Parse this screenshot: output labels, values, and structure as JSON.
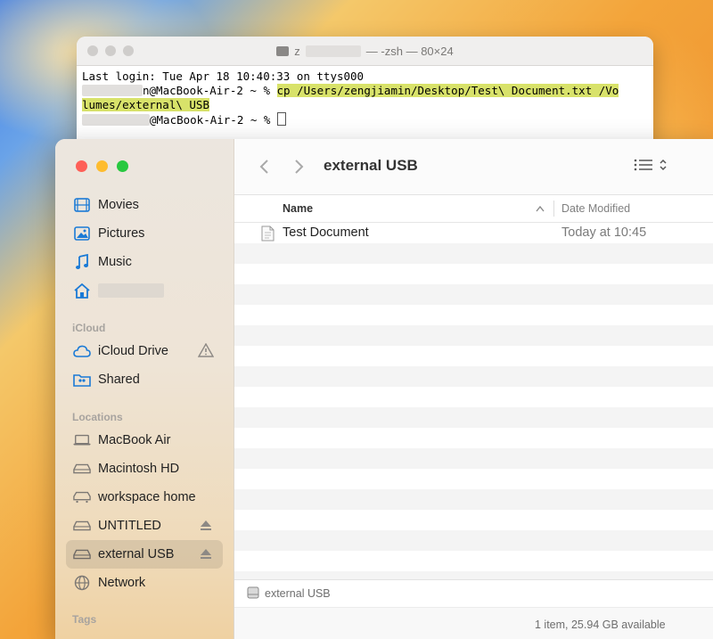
{
  "terminal": {
    "title_prefix": "z",
    "title_suffix": "— -zsh — 80×24",
    "line1": "Last login: Tue Apr 18 10:40:33 on ttys000",
    "line2_user_tail": "n@MacBook-Air-2 ~ % ",
    "line2_cmd": "cp /Users/zengjiamin/Desktop/Test\\ Document.txt /Vo",
    "line3_cmd": "lumes/external\\ USB",
    "line4_prompt": "@MacBook-Air-2 ~ % "
  },
  "finder": {
    "window_title": "external USB",
    "sidebar": {
      "favorites": [
        {
          "label": "Movies",
          "icon": "film-icon"
        },
        {
          "label": "Pictures",
          "icon": "photo-icon"
        },
        {
          "label": "Music",
          "icon": "music-note-icon"
        },
        {
          "label": "",
          "icon": "home-icon"
        }
      ],
      "icloud_heading": "iCloud",
      "icloud": [
        {
          "label": "iCloud Drive",
          "icon": "cloud-icon"
        },
        {
          "label": "Shared",
          "icon": "shared-folder-icon"
        }
      ],
      "locations_heading": "Locations",
      "locations": [
        {
          "label": "MacBook Air",
          "icon": "laptop-icon"
        },
        {
          "label": "Macintosh HD",
          "icon": "drive-icon"
        },
        {
          "label": "workspace home",
          "icon": "network-drive-icon"
        },
        {
          "label": "UNTITLED",
          "icon": "drive-icon"
        },
        {
          "label": "external USB",
          "icon": "drive-icon"
        },
        {
          "label": "Network",
          "icon": "globe-icon"
        }
      ],
      "tags_heading": "Tags"
    },
    "columns": {
      "name": "Name",
      "date": "Date Modified"
    },
    "files": [
      {
        "name": "Test Document",
        "date": "Today at 10:45"
      }
    ],
    "path_label": "external USB",
    "status": "1 item, 25.94 GB available"
  },
  "colors": {
    "close": "#fe5f57",
    "minimize": "#febc2e",
    "zoom": "#28c840",
    "accent": "#1a7ad6",
    "highlight": "#d8e26a"
  }
}
